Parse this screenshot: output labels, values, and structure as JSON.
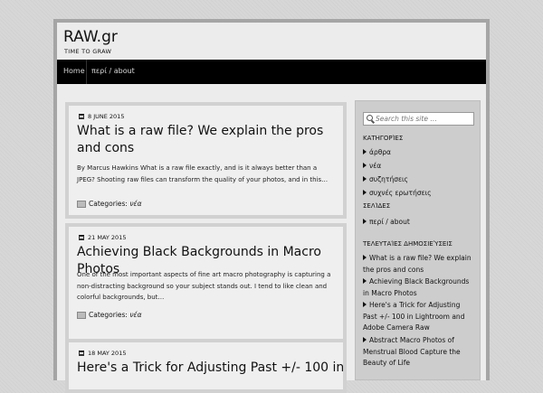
{
  "site": {
    "title": "RAW.gr",
    "tagline": "TIME TO GRAW"
  },
  "nav": {
    "items": [
      {
        "label": "Home"
      },
      {
        "label": "περί / about"
      }
    ]
  },
  "posts": [
    {
      "date": "8 JUNE 2015",
      "title": "What is a raw file? We explain the pros and cons",
      "excerpt": "By Marcus Hawkins What is a raw file exactly, and is it always better than a JPEG? Shooting raw files can transform the quality of your photos, and in this…",
      "categories_label": "Categories:",
      "category": "νέα"
    },
    {
      "date": "21 MAY 2015",
      "title": "Achieving Black Backgrounds in Macro Photos",
      "excerpt": "One of the most important aspects of fine art macro photography is capturing a non-distracting background so your subject stands out. I tend to like clean and colorful backgrounds, but…",
      "categories_label": "Categories:",
      "category": "νέα"
    },
    {
      "date": "18 MAY 2015",
      "title": "Here's a Trick for Adjusting Past +/- 100 in"
    }
  ],
  "sidebar": {
    "search_placeholder": "Search this site …",
    "categories_title": "ΚΑΤΗΓΟΡΊΕΣ",
    "categories": [
      "άρθρα",
      "νέα",
      "συζητήσεις",
      "συχνές ερωτήσεις"
    ],
    "pages_title": "ΣΕΛΊΔΕΣ",
    "pages": [
      "περί / about"
    ],
    "recent_title": "ΤΕΛΕΥΤΑΊΕΣ ΔΗΜΟΣΙΕΎΣΕΙΣ",
    "recent": [
      "What is a raw file? We explain the pros and cons",
      "Achieving Black Backgrounds in Macro Photos",
      "Here's a Trick for Adjusting Past +/- 100 in Lightroom and Adobe Camera Raw",
      "Abstract Macro Photos of Menstrual Blood Capture the Beauty of Life"
    ]
  }
}
